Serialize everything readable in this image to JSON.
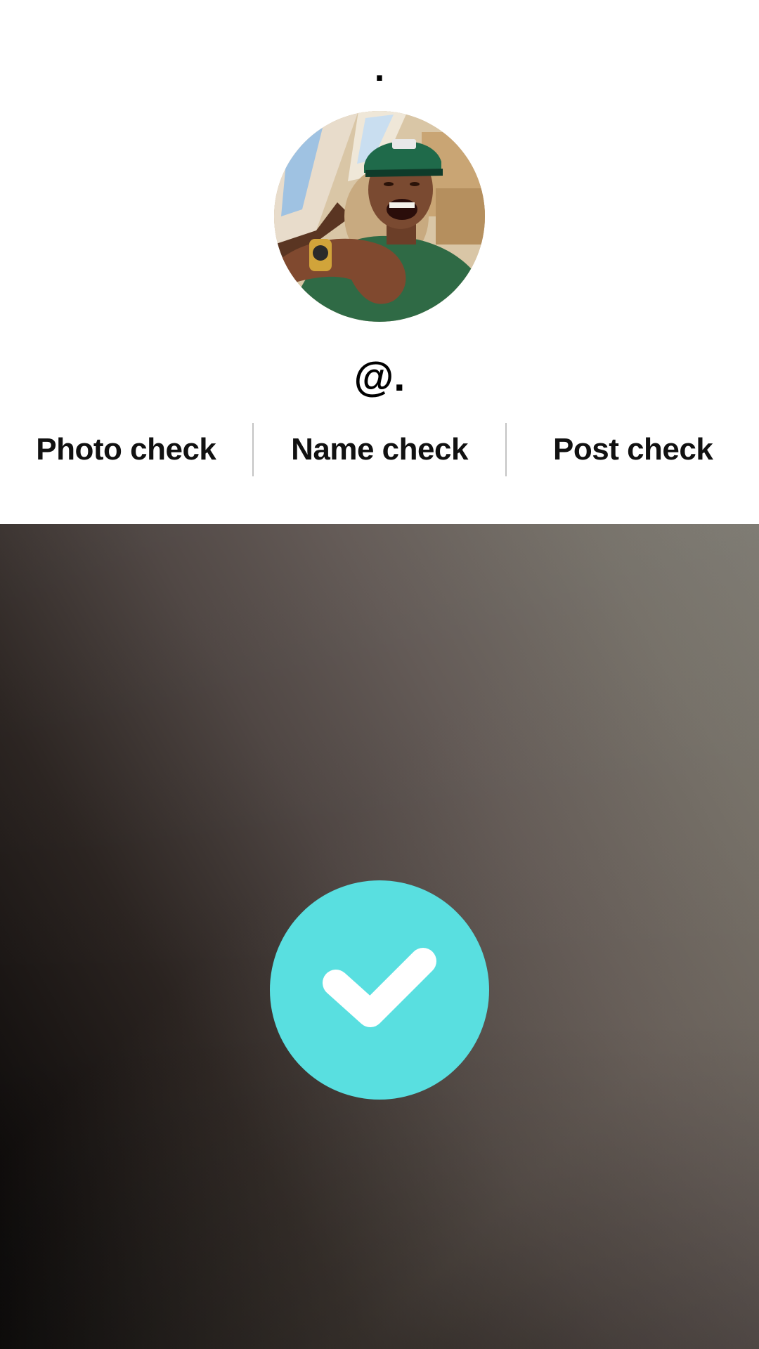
{
  "profile": {
    "top_text": ".",
    "handle": "@.",
    "avatar_icon": "profile-photo"
  },
  "checks": {
    "photo_label": "Photo check",
    "name_label": "Name check",
    "post_label": "Post check"
  },
  "status": {
    "icon": "checkmark-icon",
    "accent_color": "#59dfe0"
  }
}
